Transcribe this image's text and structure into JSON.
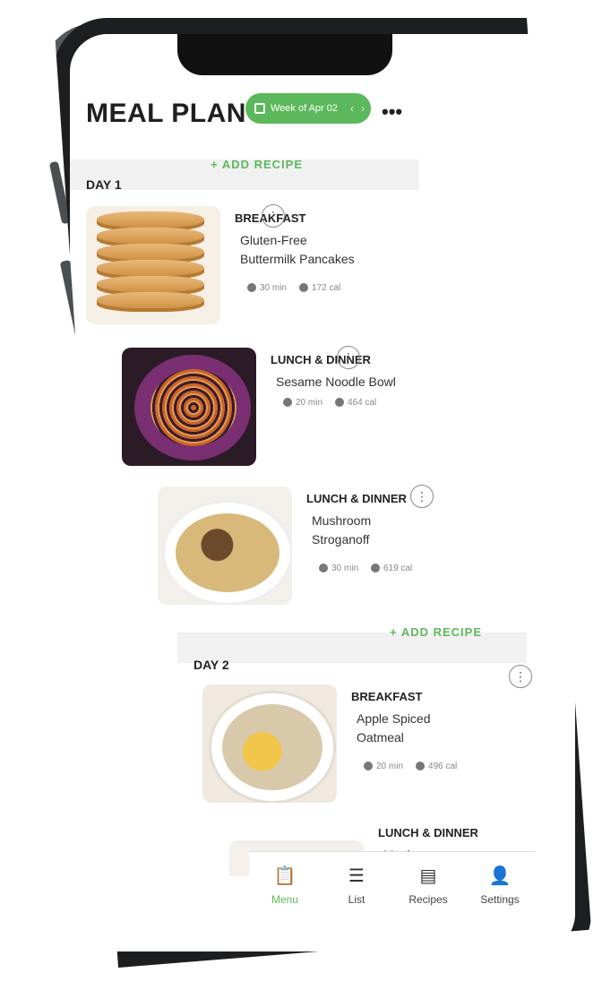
{
  "header": {
    "title": "MEAL PLAN",
    "week_label": "Week of Apr 02",
    "more_icon": "more-horizontal-icon"
  },
  "colors": {
    "accent": "#5cb85c",
    "text": "#222222",
    "section_bg": "#f1f1f1"
  },
  "days": [
    {
      "label": "DAY 1",
      "add_recipe": "+ ADD RECIPE",
      "meals": [
        {
          "type": "BREAKFAST",
          "name": "Gluten-Free Buttermilk Pancakes",
          "time": "30 min",
          "cal": "172 cal",
          "image": "pancakes"
        },
        {
          "type": "LUNCH & DINNER",
          "name": "Sesame Noodle Bowl",
          "time": "20 min",
          "cal": "464 cal",
          "image": "noodles"
        },
        {
          "type": "LUNCH & DINNER",
          "name": "Mushroom Stroganoff",
          "time": "30 min",
          "cal": "619 cal",
          "image": "stroganoff"
        }
      ]
    },
    {
      "label": "DAY 2",
      "add_recipe": "+ ADD RECIPE",
      "meals": [
        {
          "type": "BREAKFAST",
          "name": "Apple Spiced Oatmeal",
          "time": "20 min",
          "cal": "496 cal",
          "image": "oatmeal"
        },
        {
          "type": "LUNCH & DINNER",
          "name": "Mushroom",
          "time": "",
          "cal": "",
          "image": "stroganoff"
        }
      ]
    }
  ],
  "nav": [
    {
      "label": "Menu",
      "icon": "clipboard-icon",
      "active": true
    },
    {
      "label": "List",
      "icon": "list-icon",
      "active": false
    },
    {
      "label": "Recipes",
      "icon": "recipe-book-icon",
      "active": false
    },
    {
      "label": "Settings",
      "icon": "user-icon",
      "active": false
    }
  ]
}
